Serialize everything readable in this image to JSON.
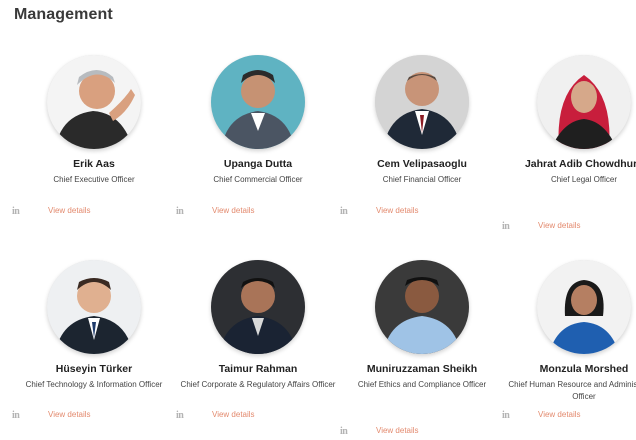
{
  "section_title": "Management",
  "colors": {
    "link": "#e38a6e",
    "icon": "#b3b3b3",
    "title": "#3a3a3a"
  },
  "people": [
    {
      "name": "Erik Aas",
      "role": "Chief Executive Officer",
      "link_icon": "in",
      "link_label": "View details"
    },
    {
      "name": "Upanga Dutta",
      "role": "Chief Commercial Officer",
      "link_icon": "in",
      "link_label": "View details"
    },
    {
      "name": "Cem Velipasaoglu",
      "role": "Chief Financial Officer",
      "link_icon": "in",
      "link_label": "View details"
    },
    {
      "name": "Jahrat Adib Chowdhury",
      "role": "Chief Legal Officer",
      "link_icon": "in",
      "link_label": "View details"
    },
    {
      "name": "Hüseyin Türker",
      "role": "Chief Technology & Information Officer",
      "link_icon": "in",
      "link_label": "View details"
    },
    {
      "name": "Taimur Rahman",
      "role": "Chief Corporate & Regulatory Affairs Officer",
      "link_icon": "in",
      "link_label": "View details"
    },
    {
      "name": "Muniruzzaman Sheikh",
      "role": "Chief Ethics and Compliance Officer",
      "link_icon": "in",
      "link_label": "View details"
    },
    {
      "name": "Monzula Morshed",
      "role": "Chief Human Resource and Administration Officer",
      "link_icon": "in",
      "link_label": "View details"
    }
  ]
}
